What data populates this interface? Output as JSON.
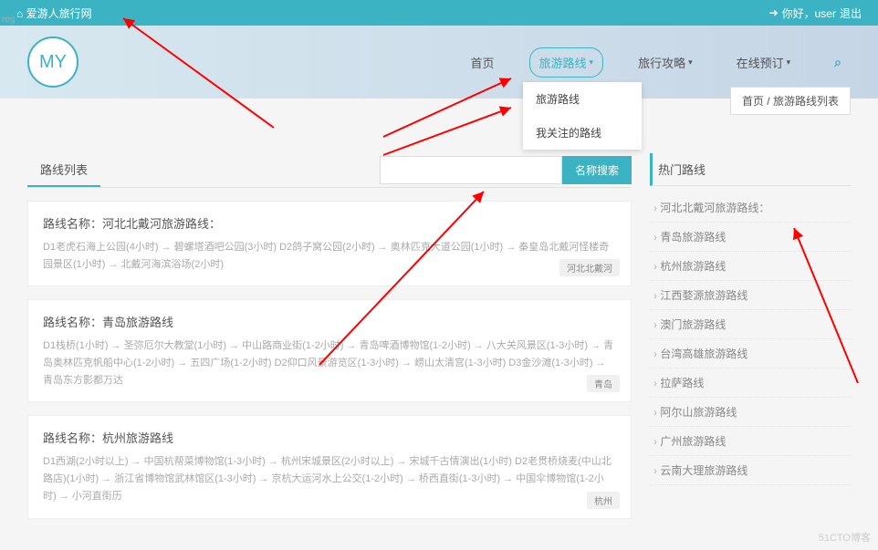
{
  "topbar": {
    "site_name": "爱游人旅行网",
    "greeting": "你好，user",
    "logout": "退出"
  },
  "logo": {
    "text": "MY",
    "tag": "reg"
  },
  "nav": {
    "home": "首页",
    "route": "旅游路线",
    "strategy": "旅行攻略",
    "booking": "在线预订"
  },
  "dropdown": {
    "item1": "旅游路线",
    "item2": "我关注的路线"
  },
  "breadcrumb": {
    "home": "首页",
    "sep": " / ",
    "page": "旅游路线列表"
  },
  "left": {
    "tab": "路线列表",
    "search_btn": "名称搜索",
    "routes": [
      {
        "title": "路线名称：河北北戴河旅游路线：",
        "desc": "D1老虎石海上公园(4小时) → 碧螺塔酒吧公园(3小时) D2鸽子窝公园(2小时) → 奥林匹克大道公园(1小时) → 秦皇岛北戴河怪楼奇园景区(1小时) → 北戴河海滨浴场(2小时)",
        "tag": "河北北戴河"
      },
      {
        "title": "路线名称：青岛旅游路线",
        "desc": "D1栈桥(1小时) → 圣弥厄尔大教堂(1小时) → 中山路商业街(1-2小时) → 青岛啤酒博物馆(1-2小时) → 八大关风景区(1-3小时) → 青岛奥林匹克帆船中心(1-2小时) → 五四广场(1-2小时) D2仰口风景游览区(1-3小时) → 崂山太清宫(1-3小时) D3金沙滩(1-3小时) → 青岛东方影都万达",
        "tag": "青岛"
      },
      {
        "title": "路线名称：杭州旅游路线",
        "desc": "D1西湖(2小时以上) → 中国杭帮菜博物馆(1-3小时) → 杭州宋城景区(2小时以上) → 宋城千古情演出(1小时) D2老贯桥烧麦(中山北路店)(1小时) → 浙江省博物馆武林馆区(1-3小时) → 京杭大运河水上公交(1-2小时) → 桥西直街(1-3小时) → 中国伞博物馆(1-2小时) → 小河直街历",
        "tag": "杭州"
      }
    ]
  },
  "hot": {
    "title": "热门路线",
    "items": [
      "河北北戴河旅游路线：",
      "青岛旅游路线",
      "杭州旅游路线",
      "江西婺源旅游路线",
      "澳门旅游路线",
      "台湾高雄旅游路线",
      "拉萨路线",
      "阿尔山旅游路线",
      "广州旅游路线",
      "云南大理旅游路线"
    ]
  },
  "watermark": "51CTO博客"
}
